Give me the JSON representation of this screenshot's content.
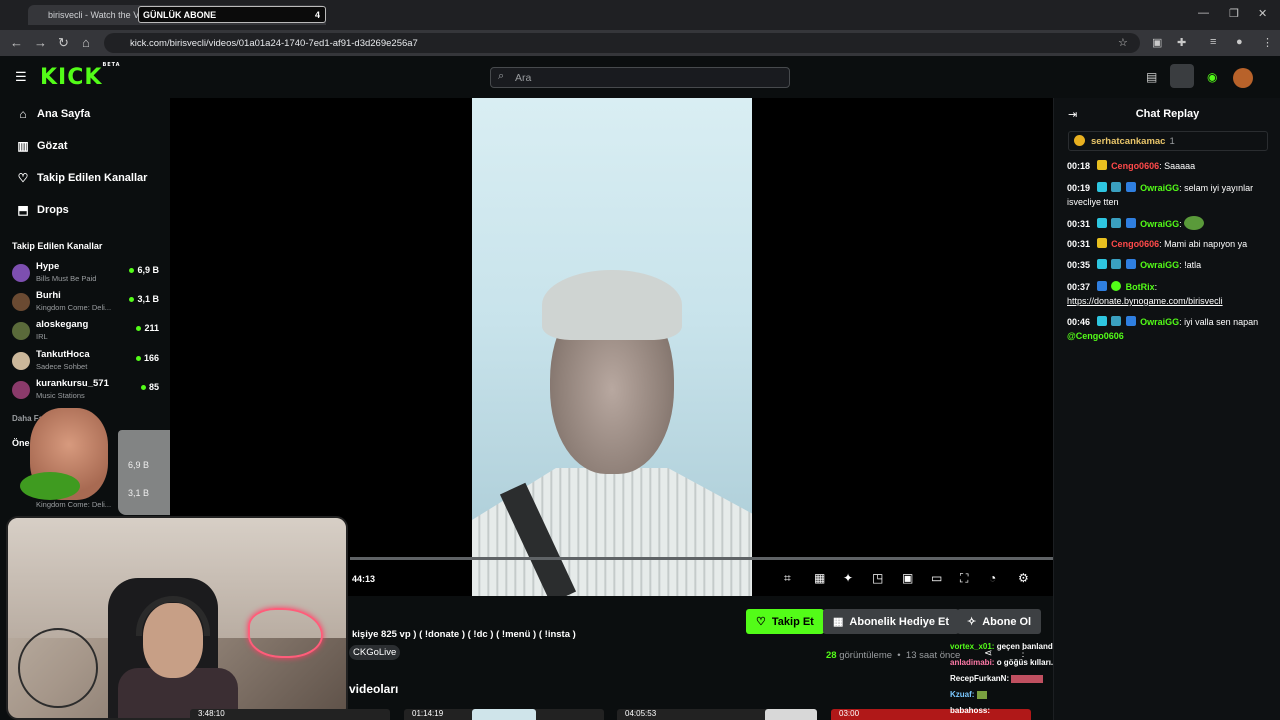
{
  "browser": {
    "tab_title": "birisvecli - Watch the VOD",
    "overlay_label": "GÜNLÜK ABONE",
    "overlay_count": "4",
    "url": "kick.com/birisvecli/videos/01a01a24-1740-7ed1-af91-d3d269e256a7"
  },
  "header": {
    "logo": "KICK",
    "logo_badge": "BETA",
    "search_placeholder": "Ara"
  },
  "sidebar": {
    "nav": [
      {
        "icon": "home-icon",
        "label": "Ana Sayfa"
      },
      {
        "icon": "browse-icon",
        "label": "Gözat"
      },
      {
        "icon": "heart-icon",
        "label": "Takip Edilen Kanallar"
      },
      {
        "icon": "drops-icon",
        "label": "Drops"
      }
    ],
    "followed_title": "Takip Edilen Kanallar",
    "channels": [
      {
        "name": "Hype",
        "category": "Bills Must Be Paid",
        "viewers": "6,9 B",
        "color": "#7d4fb0"
      },
      {
        "name": "Burhi",
        "category": "Kingdom Come: Deli...",
        "viewers": "3,1 B",
        "color": "#6a4a32"
      },
      {
        "name": "aloskegang",
        "category": "IRL",
        "viewers": "211",
        "color": "#5a6a3a"
      },
      {
        "name": "TankutHoca",
        "category": "Sadece Sohbet",
        "viewers": "166",
        "color": "#cbb79a"
      },
      {
        "name": "kurankursu_571",
        "category": "Music Stations",
        "viewers": "85",
        "color": "#8a3a6a"
      }
    ],
    "show_more": "Daha Fazla",
    "recommended_title": "Öne",
    "rec_category": "Kingdom Come: Deli...",
    "glass_viewers_1": "6,9 B",
    "glass_viewers_2": "3,1 B"
  },
  "video": {
    "time": "44:13"
  },
  "info": {
    "follow_label": "Takip Et",
    "gift_label": "Abonelik Hediye Et",
    "sub_label": "Abone Ol",
    "description": "kişiye 825 vp ) ( !donate ) ( !dc ) ( !menü ) ( !insta )",
    "tag": "CKGoLive",
    "views_count": "28",
    "views_label": "görüntüleme",
    "ago": "13 saat önce",
    "videos_title": "videoları",
    "thumbs": [
      "3:48:10",
      "01:14:19",
      "",
      "04:05:53",
      "",
      "03:00"
    ]
  },
  "mini_chat": [
    {
      "user": "vortex_x01:",
      "text": "geçen banlandım",
      "color": "#53fc18"
    },
    {
      "user": "anladimabi:",
      "text": "o göğüs kılları...",
      "color": "#ff7aa8"
    },
    {
      "user": "RecepFurkanN:",
      "text": "",
      "color": "#fff"
    },
    {
      "user": "Kzuaf:",
      "text": "",
      "color": "#7ac8ff"
    },
    {
      "user": "babahoss:",
      "text": "",
      "color": "#fff"
    }
  ],
  "chat": {
    "title": "Chat Replay",
    "pinned_user": "serhatcankamac",
    "pinned_count": "1",
    "messages": [
      {
        "ts": "00:18",
        "user": "Cengo0606",
        "color": "#ff4a4a",
        "text": ": Saaaaa"
      },
      {
        "ts": "00:19",
        "user": "OwraiGG",
        "color": "#53fc18",
        "text": ": selam iyi yayınlar isvecliye tten"
      },
      {
        "ts": "00:31",
        "user": "OwraiGG",
        "color": "#53fc18",
        "text": ":"
      },
      {
        "ts": "00:31",
        "user": "Cengo0606",
        "color": "#ff4a4a",
        "text": ": Mami abi napıyon ya"
      },
      {
        "ts": "00:35",
        "user": "OwraiGG",
        "color": "#53fc18",
        "text": ": !atla"
      },
      {
        "ts": "00:37",
        "user": "BotRix",
        "color": "#53fc18",
        "text": ":",
        "link": "https://donate.bynogame.com/birisvecli"
      },
      {
        "ts": "00:46",
        "user": "OwraiGG",
        "color": "#53fc18",
        "text": ": iyi valla sen napan",
        "mention": "@Cengo0606"
      }
    ]
  }
}
